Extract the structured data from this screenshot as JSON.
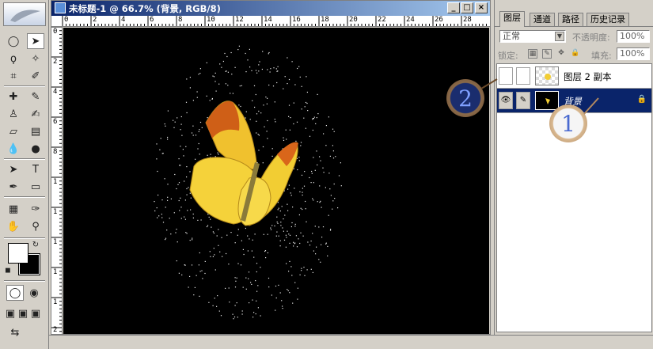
{
  "document": {
    "title": "未标题-1 @ 66.7% (背景, RGB/8)",
    "minimize_label": "_",
    "maximize_label": "□",
    "close_label": "×",
    "ruler_top_ticks": [
      "0",
      "2",
      "4",
      "6",
      "8",
      "10",
      "12",
      "14",
      "16",
      "18",
      "20",
      "22",
      "24",
      "26",
      "28"
    ],
    "ruler_left_ticks": [
      "0",
      "2",
      "4",
      "6",
      "8",
      "1",
      "1",
      "1",
      "1",
      "1",
      "2",
      "2",
      "2",
      "2",
      "2"
    ]
  },
  "panel": {
    "tabs": [
      "图层",
      "通道",
      "路径",
      "历史记录"
    ],
    "blend_mode": "正常",
    "opacity_label": "不透明度:",
    "opacity_value": "100%",
    "lock_label": "锁定:",
    "fill_label": "填充:",
    "fill_value": "100%",
    "layers": [
      {
        "name": "图层 2 副本",
        "visible": false,
        "selected": false
      },
      {
        "name": "背景",
        "visible": true,
        "selected": true
      }
    ]
  },
  "callouts": [
    "2",
    "1"
  ],
  "colors": {
    "title_bar": "#0a246a",
    "selected_layer": "#0a246a",
    "canvas": "#000000",
    "butterfly_yellow": "#f5d23a",
    "butterfly_orange": "#e0791a",
    "callout_ring": "#8a6a4a"
  }
}
